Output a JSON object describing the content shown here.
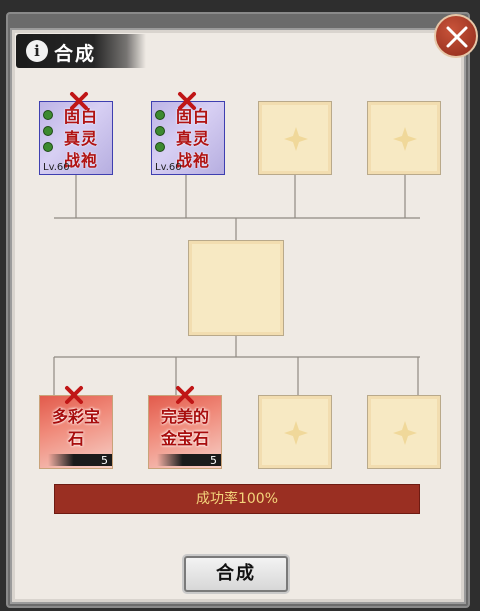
{
  "dialog": {
    "title": "合成",
    "info_icon": "info-icon",
    "close_icon": "close-icon"
  },
  "materials_top": [
    {
      "name": "固白真灵战袍",
      "line1": "固白",
      "line2": "真灵",
      "line3": "战袍",
      "level": "Lv.60"
    },
    {
      "name": "固白真灵战袍",
      "line1": "固白",
      "line2": "真灵",
      "line3": "战袍",
      "level": "Lv.60"
    }
  ],
  "gems_bottom": [
    {
      "line1": "多彩宝",
      "line2": "石",
      "count": "5"
    },
    {
      "line1": "完美的",
      "line2": "金宝石",
      "count": "5"
    }
  ],
  "empty_slot_icon": "plus-icon",
  "success_rate": "成功率100%",
  "combine_button": "合成",
  "colors": {
    "panel_bg": "#efeae4",
    "slot_bg": "#f7e9c3",
    "rate_bar": "#9a2f22",
    "rate_text": "#f3d37a"
  }
}
